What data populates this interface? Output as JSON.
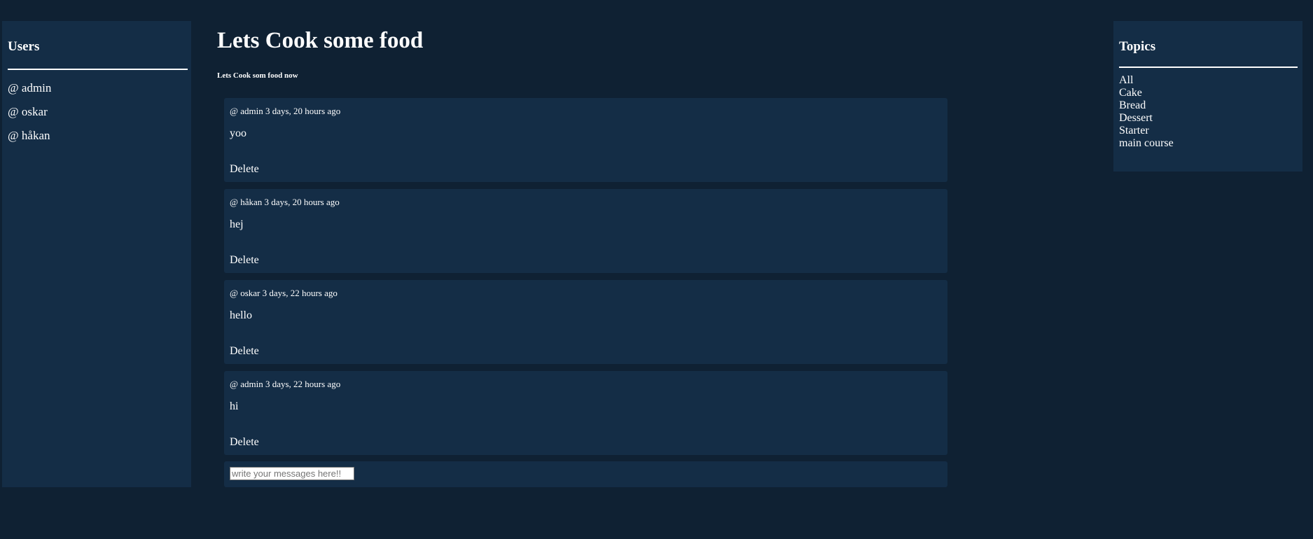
{
  "users_panel": {
    "title": "Users",
    "users": [
      "@ admin",
      "@ oskar",
      "@ håkan"
    ]
  },
  "main": {
    "title": "Lets Cook some food",
    "subtitle": "Lets Cook som food now",
    "messages": [
      {
        "meta": "@ admin 3 days, 20 hours ago",
        "body": "yoo",
        "delete_label": "Delete"
      },
      {
        "meta": "@ håkan 3 days, 20 hours ago",
        "body": "hej",
        "delete_label": "Delete"
      },
      {
        "meta": "@ oskar 3 days, 22 hours ago",
        "body": "hello",
        "delete_label": "Delete"
      },
      {
        "meta": "@ admin 3 days, 22 hours ago",
        "body": "hi",
        "delete_label": "Delete"
      }
    ],
    "composer": {
      "placeholder": "write your messages here!!",
      "value": ""
    }
  },
  "topics_panel": {
    "title": "Topics",
    "topics": [
      "All",
      "Cake",
      "Bread",
      "Dessert",
      "Starter",
      "main course"
    ]
  }
}
